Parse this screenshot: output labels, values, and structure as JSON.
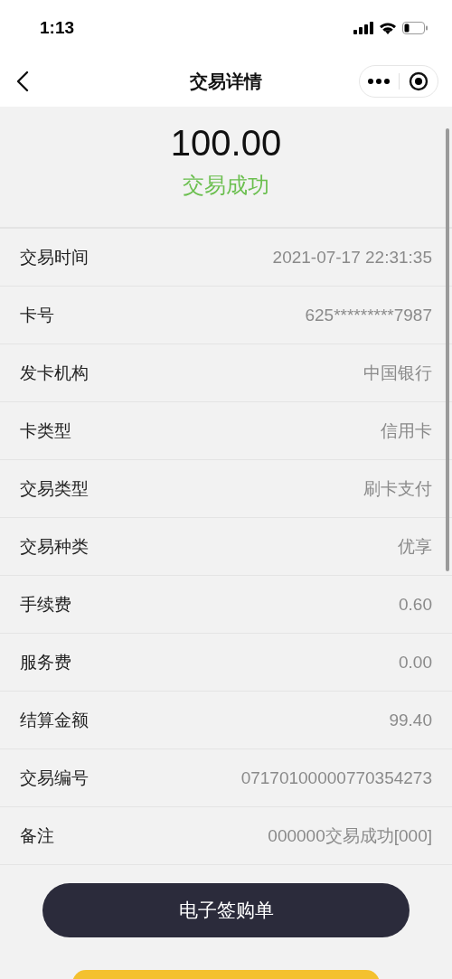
{
  "status_bar": {
    "time": "1:13"
  },
  "nav": {
    "title": "交易详情"
  },
  "summary": {
    "amount": "100.00",
    "status": "交易成功"
  },
  "details": [
    {
      "label": "交易时间",
      "value": "2021-07-17 22:31:35"
    },
    {
      "label": "卡号",
      "value": "625*********7987"
    },
    {
      "label": "发卡机构",
      "value": "中国银行"
    },
    {
      "label": "卡类型",
      "value": "信用卡"
    },
    {
      "label": "交易类型",
      "value": "刷卡支付"
    },
    {
      "label": "交易种类",
      "value": "优享"
    },
    {
      "label": "手续费",
      "value": "0.60"
    },
    {
      "label": "服务费",
      "value": "0.00"
    },
    {
      "label": "结算金额",
      "value": "99.40"
    },
    {
      "label": "交易编号",
      "value": "07170100000770354273"
    },
    {
      "label": "备注",
      "value": "000000交易成功[000]"
    }
  ],
  "buttons": [
    {
      "label": "电子签购单",
      "kind": "primary"
    }
  ]
}
